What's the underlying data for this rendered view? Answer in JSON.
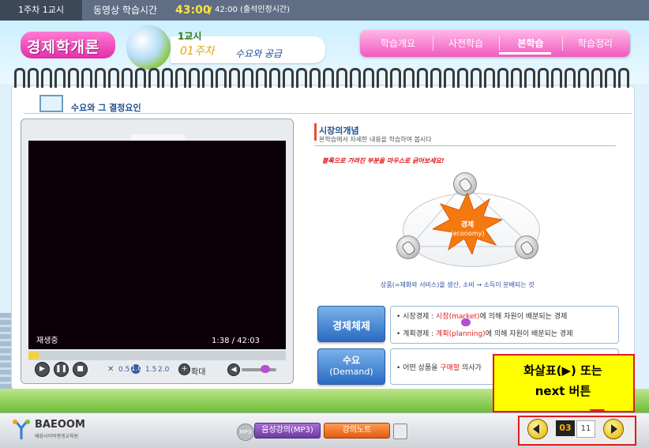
{
  "topbar": {
    "week_session": "1주차 1교시",
    "study_time_label": "동영상 학습시간",
    "elapsed": "43:00",
    "separator": "/",
    "required": "42:00 (출석인정시간)"
  },
  "header": {
    "course_title": "경제학개론",
    "session": "1교시",
    "week": "01주차",
    "topic": "수요와 공급"
  },
  "nav": {
    "items": [
      "학습개요",
      "사전학습",
      "본학습",
      "학습정리"
    ],
    "active": "본학습"
  },
  "section": {
    "title": "수요와 그 결정요인"
  },
  "player": {
    "status": "재생중",
    "time": "1:38  / 42:03",
    "speeds": [
      "0.5",
      "1.0",
      "1.5",
      "2.0"
    ],
    "selected_speed": "1.0",
    "zoom_label": "확대",
    "seek_progress": 0.04
  },
  "concept": {
    "title": "시장의개념",
    "subtitle": "본학습에서 자세한 내용을 학습하여 봅시다",
    "hint": "블록으로 가려진 부분을 마우스로 긁어보세요!",
    "center_label": "경제",
    "center_label_en": "(economy)",
    "goods_line": "상품(=재화와 서비스)을 생산, 소비 → 소득이 분배되는 것"
  },
  "economic_system": {
    "button": "경제체제",
    "line1_prefix": "시장경제 : ",
    "line1_highlight": "시장(market)",
    "line1_suffix": "에 의해 자원이 배분되는 경제",
    "line2_prefix": "계획경제 : ",
    "line2_highlight": "계획(planning)",
    "line2_suffix": "에 의해 자원이 배분되는 경제"
  },
  "demand": {
    "button_line1": "수요",
    "button_line2": "(Demand)",
    "line_prefix": "어떤 상품을 ",
    "line_highlight": "구매할",
    "line_suffix": " 의사가"
  },
  "callout": {
    "line1": "화살표(▶) 또는",
    "line2": "next 버튼"
  },
  "footer": {
    "logo_name": "BAEOOM",
    "logo_sub": "배움사이버평생교육원",
    "mp3_icon": "MP3",
    "mp3_button": "음성강의(MP3)",
    "note_button": "강의노트",
    "page_current": "03",
    "page_total": "11"
  },
  "colors": {
    "accent_pink": "#f05ac0",
    "accent_blue": "#2a6bc2",
    "highlight_red": "#e11a1a",
    "callout_yellow": "#ffff00"
  }
}
